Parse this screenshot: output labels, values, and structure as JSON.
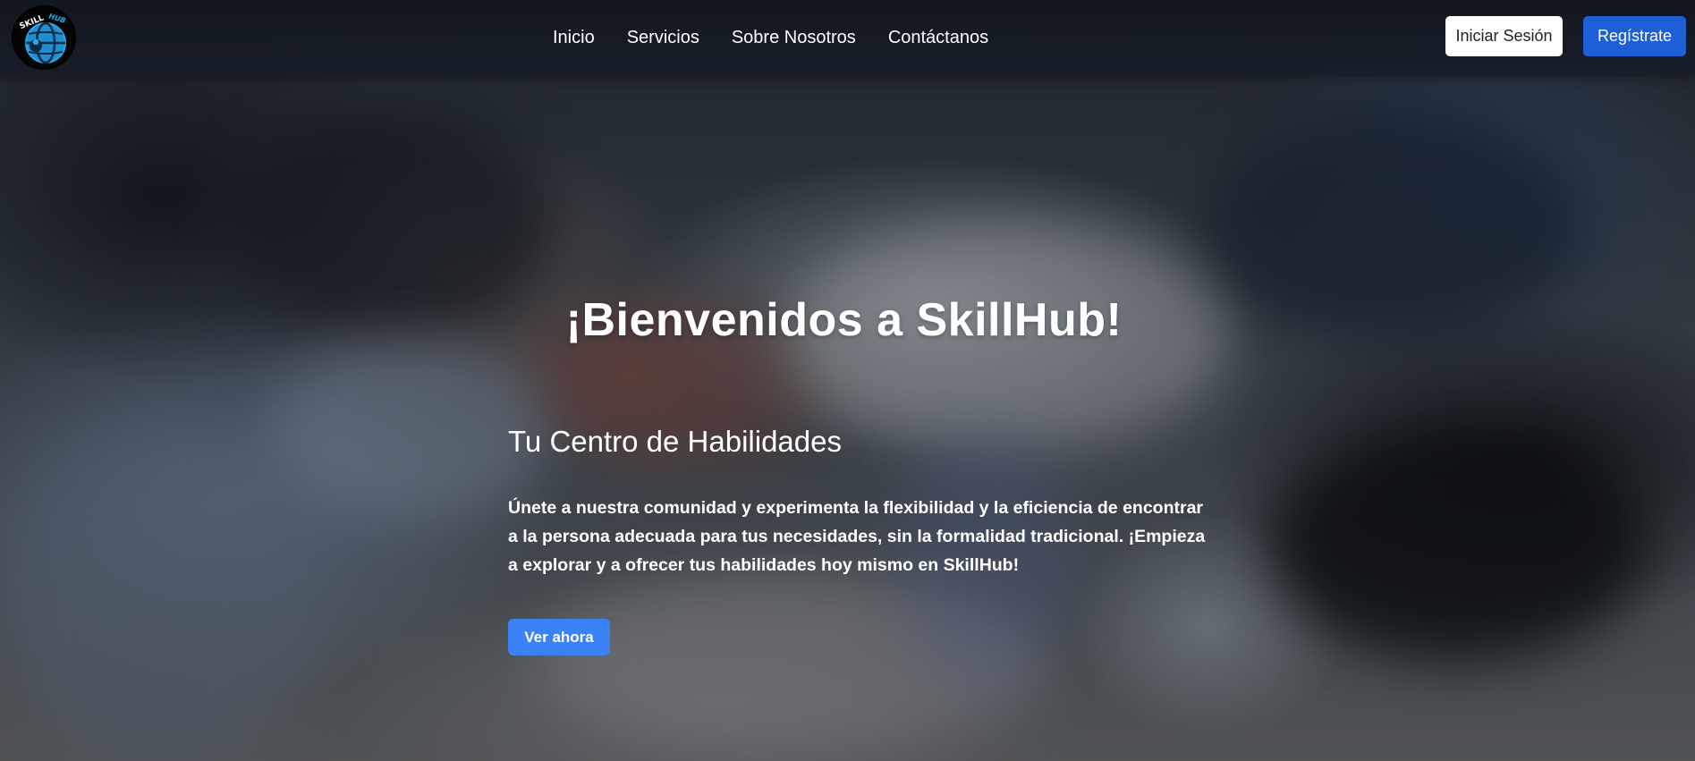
{
  "navbar": {
    "logo_text": "SKILL HUB",
    "links": [
      {
        "label": "Inicio"
      },
      {
        "label": "Servicios"
      },
      {
        "label": "Sobre Nosotros"
      },
      {
        "label": "Contáctanos"
      }
    ],
    "login_label": "Iniciar Sesión",
    "register_label": "Regístrate"
  },
  "hero": {
    "title": "¡Bienvenidos a SkillHub!",
    "subtitle": "Tu Centro de Habilidades",
    "text": "Únete a nuestra comunidad y experimenta la flexibilidad y la eficiencia de encontrar a la persona adecuada para tus necesidades, sin la formalidad tradicional. ¡Empieza a explorar y a ofrecer tus habilidades hoy mismo en SkillHub!",
    "cta_label": "Ver ahora"
  },
  "colors": {
    "primary": "#1d5fd6",
    "cta": "#3b82f6",
    "navbar": "#161c26",
    "logo_accent": "#29a9e8"
  },
  "icons": {
    "logo": "skillhub-globe-logo"
  }
}
